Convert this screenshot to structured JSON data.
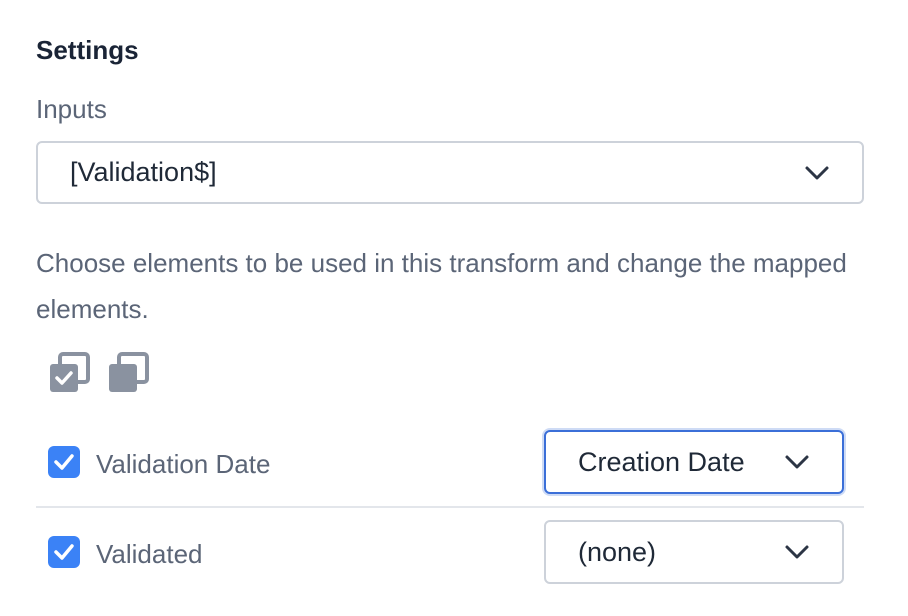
{
  "settings": {
    "heading": "Settings",
    "inputs_label": "Inputs",
    "inputs_value": "[Validation$]",
    "help_text": "Choose elements to be used in this transform and change the mapped elements."
  },
  "toolbar": {
    "select_all_icon": "select-all-icon",
    "deselect_all_icon": "deselect-all-icon"
  },
  "mappings": [
    {
      "label": "Validation Date",
      "checked": true,
      "mapped_to": "Creation Date",
      "focused": true
    },
    {
      "label": "Validated",
      "checked": true,
      "mapped_to": "(none)",
      "focused": false
    }
  ],
  "colors": {
    "accent": "#3b82f6",
    "focus_border": "#3b6fd8",
    "text_dark": "#1a2436",
    "text_muted": "#5b6577",
    "icon_gray": "#8a92a0"
  }
}
